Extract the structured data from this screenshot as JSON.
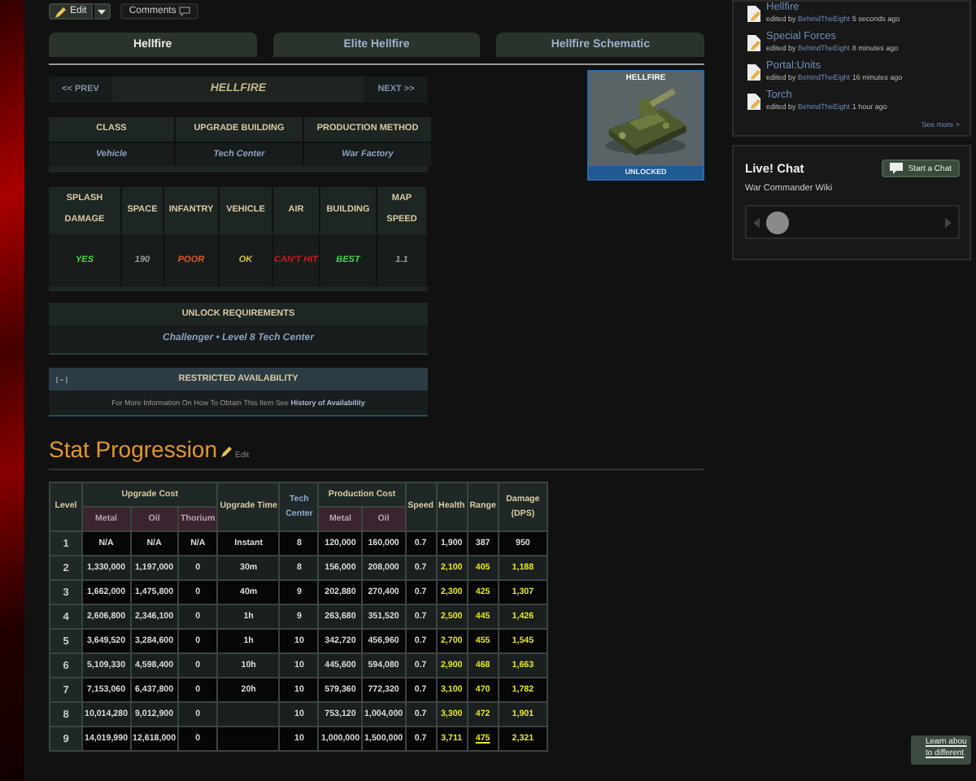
{
  "toolbar": {
    "edit_label": "Edit",
    "comments_label": "Comments"
  },
  "tabs": [
    {
      "label": "Hellfire",
      "selected": true
    },
    {
      "label": "Elite Hellfire",
      "selected": false
    },
    {
      "label": "Hellfire Schematic",
      "selected": false
    }
  ],
  "nav": {
    "prev": "<< PREV",
    "title": "HELLFIRE",
    "next": "NEXT >>"
  },
  "info_table": [
    {
      "heading": "CLASS",
      "value": "Vehicle"
    },
    {
      "heading": "UPGRADE BUILDING",
      "value": "Tech Center"
    },
    {
      "heading": "PRODUCTION METHOD",
      "value": "War Factory"
    }
  ],
  "stats": [
    {
      "label": "SPLASH DAMAGE",
      "value": "YES",
      "color": "#3fd93f"
    },
    {
      "label": "SPACE",
      "value": "190",
      "color": "#9a9a9a"
    },
    {
      "label": "INFANTRY",
      "value": "POOR",
      "color": "#e8541c"
    },
    {
      "label": "VEHICLE",
      "value": "OK",
      "color": "#d8c81c"
    },
    {
      "label": "AIR",
      "value": "CAN'T HIT",
      "color": "#d01818"
    },
    {
      "label": "BUILDING",
      "value": "BEST",
      "color": "#3fd93f"
    },
    {
      "label": "MAP SPEED",
      "value": "1.1",
      "color": "#9a9a9a"
    }
  ],
  "unlock": {
    "title": "UNLOCK REQUIREMENTS",
    "requirements": "Challenger • Level 8 Tech Center"
  },
  "restricted": {
    "title": "RESTRICTED AVAILABILITY",
    "text": "For More Information On How To Obtain This Item See",
    "link": "History of Availability"
  },
  "unit_card": {
    "title": "HELLFIRE",
    "status": "UNLOCKED"
  },
  "section": {
    "heading": "Stat Progression",
    "edit": "Edit"
  },
  "progression": {
    "headers": {
      "level": "Level",
      "upgrade_cost": "Upgrade Cost",
      "upgrade_sub": [
        "Metal",
        "Oil",
        "Thorium"
      ],
      "upgrade_time": "Upgrade Time",
      "tech_center": "Tech Center",
      "production_cost": "Production Cost",
      "production_sub": [
        "Metal",
        "Oil"
      ],
      "speed": "Speed",
      "health": "Health",
      "range": "Range",
      "damage": "Damage (DPS)"
    },
    "rows": [
      {
        "level": "1",
        "cells": [
          "N/A",
          "N/A",
          "N/A",
          "Instant",
          "8",
          "120,000",
          "160,000",
          "0.7",
          "1,900",
          "387",
          "950"
        ],
        "upgraded": false,
        "range_link": false
      },
      {
        "level": "2",
        "cells": [
          "1,330,000",
          "1,197,000",
          "0",
          "30m",
          "8",
          "156,000",
          "208,000",
          "0.7",
          "2,100",
          "405",
          "1,188"
        ],
        "upgraded": true,
        "range_link": false
      },
      {
        "level": "3",
        "cells": [
          "1,662,000",
          "1,475,800",
          "0",
          "40m",
          "9",
          "202,880",
          "270,400",
          "0.7",
          "2,300",
          "425",
          "1,307"
        ],
        "upgraded": true,
        "range_link": false
      },
      {
        "level": "4",
        "cells": [
          "2,606,800",
          "2,346,100",
          "0",
          "1h",
          "9",
          "263,680",
          "351,520",
          "0.7",
          "2,500",
          "445",
          "1,426"
        ],
        "upgraded": true,
        "range_link": false
      },
      {
        "level": "5",
        "cells": [
          "3,649,520",
          "3,284,600",
          "0",
          "1h",
          "10",
          "342,720",
          "456,960",
          "0.7",
          "2,700",
          "455",
          "1,545"
        ],
        "upgraded": true,
        "range_link": false
      },
      {
        "level": "6",
        "cells": [
          "5,109,330",
          "4,598,400",
          "0",
          "10h",
          "10",
          "445,600",
          "594,080",
          "0.7",
          "2,900",
          "468",
          "1,663"
        ],
        "upgraded": true,
        "range_link": false
      },
      {
        "level": "7",
        "cells": [
          "7,153,060",
          "6,437,800",
          "0",
          "20h",
          "10",
          "579,360",
          "772,320",
          "0.7",
          "3,100",
          "470",
          "1,782"
        ],
        "upgraded": true,
        "range_link": false
      },
      {
        "level": "8",
        "cells": [
          "10,014,280",
          "9,012,900",
          "0",
          null,
          "10",
          "753,120",
          "1,004,000",
          "0.7",
          "3,300",
          "472",
          "1,901"
        ],
        "upgraded": true,
        "range_link": false
      },
      {
        "level": "9",
        "cells": [
          "14,019,990",
          "12,618,000",
          "0",
          null,
          "10",
          "1,000,000",
          "1,500,000",
          "0.7",
          "3,711",
          "475",
          "2,321"
        ],
        "upgraded": true,
        "range_link": true
      }
    ]
  },
  "recent_edits": {
    "items": [
      {
        "title": "Hellfire",
        "prefix": "edited by",
        "editor": "BehindTheEight",
        "time": "5 seconds ago"
      },
      {
        "title": "Special Forces",
        "prefix": "edited by",
        "editor": "BehindTheEight",
        "time": "8 minutes ago"
      },
      {
        "title": "Portal:Units",
        "prefix": "edited by",
        "editor": "BehindTheEight",
        "time": "16 minutes ago"
      },
      {
        "title": "Torch",
        "prefix": "edited by",
        "editor": "BehindTheEight",
        "time": "1 hour ago"
      }
    ],
    "see_more": "See more >"
  },
  "chat": {
    "title": "Live! Chat",
    "button": "Start a Chat",
    "wiki": "War Commander Wiki"
  },
  "toast": {
    "lines": [
      "Learn abou",
      "to different"
    ]
  }
}
